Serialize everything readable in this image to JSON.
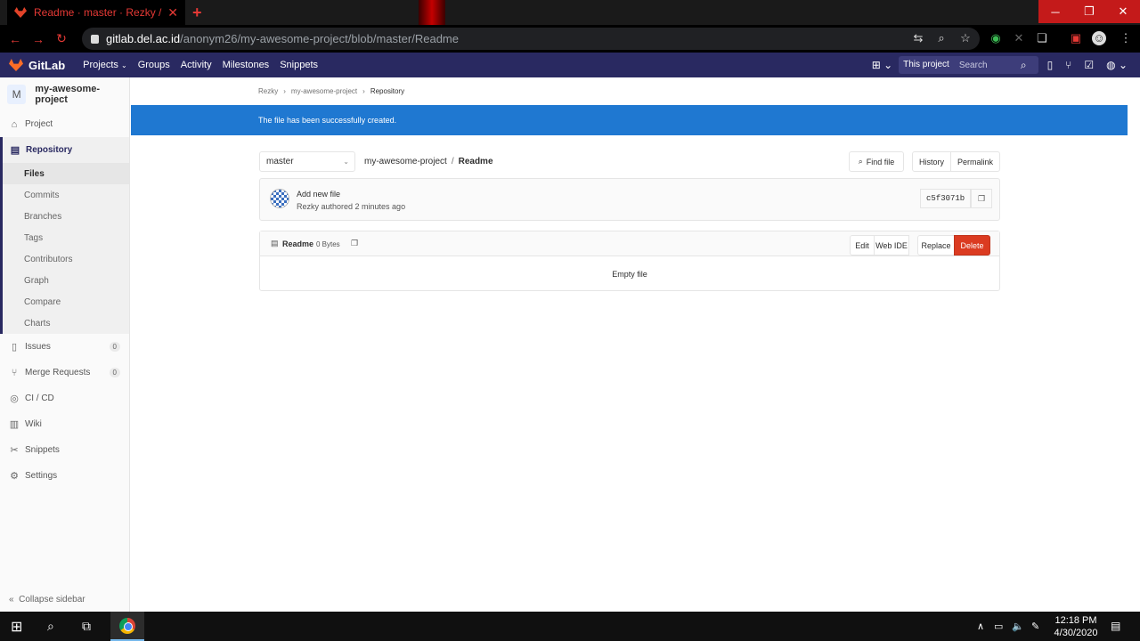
{
  "browser": {
    "tab_title": "Readme · master · Rezky / my-awesome-project",
    "url_host": "gitlab.del.ac.id",
    "url_path": "/anonym26/my-awesome-project/blob/master/Readme"
  },
  "header": {
    "brand": "GitLab",
    "nav": [
      "Projects",
      "Groups",
      "Activity",
      "Milestones",
      "Snippets"
    ],
    "scope": "This project",
    "search_placeholder": "Search"
  },
  "sidebar": {
    "avatar_letter": "M",
    "project_name": "my-awesome-project",
    "project": "Project",
    "repository": "Repository",
    "repo_items": [
      "Files",
      "Commits",
      "Branches",
      "Tags",
      "Contributors",
      "Graph",
      "Compare",
      "Charts"
    ],
    "issues": "Issues",
    "issues_count": "0",
    "merge_requests": "Merge Requests",
    "mr_count": "0",
    "cicd": "CI / CD",
    "wiki": "Wiki",
    "snippets": "Snippets",
    "settings": "Settings",
    "collapse": "Collapse sidebar"
  },
  "breadcrumb": [
    "Rezky",
    "my-awesome-project",
    "Repository"
  ],
  "flash": "The file has been successfully created.",
  "branch": "master",
  "path": {
    "project": "my-awesome-project",
    "sep": "/",
    "file": "Readme"
  },
  "buttons": {
    "find_file": "Find file",
    "history": "History",
    "permalink": "Permalink",
    "edit": "Edit",
    "web_ide": "Web IDE",
    "replace": "Replace",
    "delete": "Delete"
  },
  "commit": {
    "message": "Add new file",
    "meta": "Rezky authored 2 minutes ago",
    "sha": "c5f3071b"
  },
  "file": {
    "name": "Readme",
    "size": "0 Bytes",
    "empty": "Empty file"
  },
  "taskbar": {
    "time": "12:18 PM",
    "date": "4/30/2020"
  }
}
